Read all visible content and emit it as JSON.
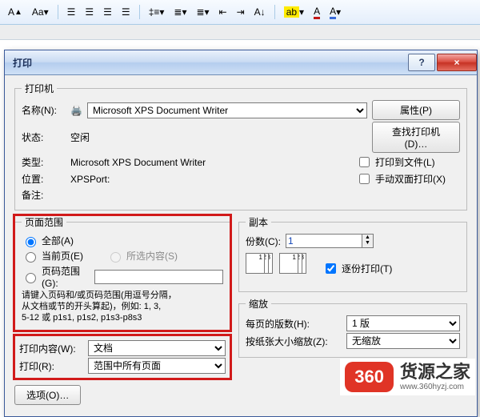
{
  "dialog": {
    "title": "打印",
    "help_icon": "?",
    "close_icon": "×"
  },
  "printer": {
    "legend": "打印机",
    "name_label": "名称(N):",
    "name_value": "Microsoft XPS Document Writer",
    "properties_btn": "属性(P)",
    "status_label": "状态:",
    "status_value": "空闲",
    "find_btn": "查找打印机(D)…",
    "type_label": "类型:",
    "type_value": "Microsoft XPS Document Writer",
    "where_label": "位置:",
    "where_value": "XPSPort:",
    "comment_label": "备注:",
    "to_file_label": "打印到文件(L)",
    "duplex_label": "手动双面打印(X)"
  },
  "page_range": {
    "legend": "页面范围",
    "all_label": "全部(A)",
    "current_label": "当前页(E)",
    "selection_label": "所选内容(S)",
    "pages_label": "页码范围(G):",
    "hint1": "请键入页码和/或页码范围(用逗号分隔，",
    "hint2": "从文档或节的开头算起)，例如: 1, 3,",
    "hint3": "5-12 或 p1s1, p1s2, p1s3-p8s3"
  },
  "copies": {
    "legend": "副本",
    "copies_label": "份数(C):",
    "copies_value": "1",
    "collate_label": "逐份打印(T)"
  },
  "print_what": {
    "what_label": "打印内容(W):",
    "what_value": "文档",
    "range_label": "打印(R):",
    "range_value": "范围中所有页面"
  },
  "zoom": {
    "legend": "缩放",
    "per_sheet_label": "每页的版数(H):",
    "per_sheet_value": "1 版",
    "scale_label": "按纸张大小缩放(Z):",
    "scale_value": "无缩放"
  },
  "buttons": {
    "options": "选项(O)…"
  },
  "logo": {
    "badge": "360",
    "brand": "货源之家",
    "url": "www.360hyzj.com"
  }
}
